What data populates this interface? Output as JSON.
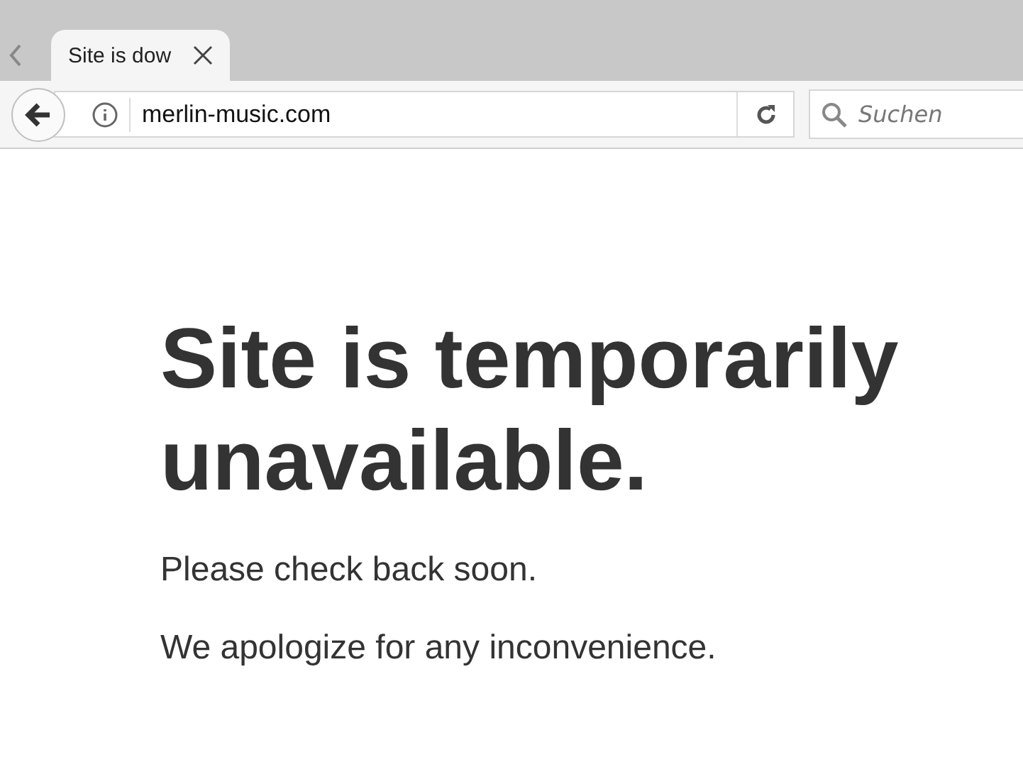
{
  "tab": {
    "title": "Site is dow"
  },
  "address_bar": {
    "url": "merlin-music.com"
  },
  "search": {
    "placeholder": "Suchen"
  },
  "page": {
    "heading": "Site is temporarily unavailable.",
    "paragraphs": [
      "Please check back soon.",
      "We apologize for any inconvenience."
    ]
  }
}
